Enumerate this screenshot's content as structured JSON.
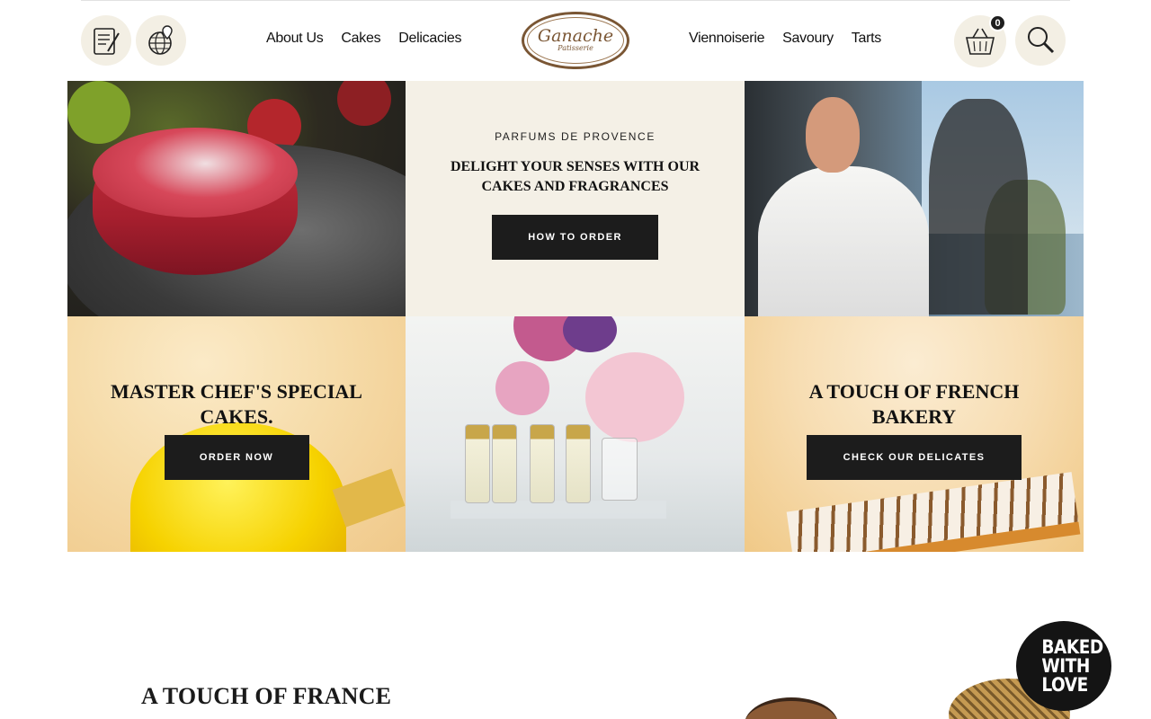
{
  "header": {
    "nav_left": [
      "About Us",
      "Cakes",
      "Delicacies"
    ],
    "nav_right": [
      "Viennoiserie",
      "Savoury",
      "Tarts"
    ],
    "logo": {
      "name": "Ganache",
      "sub": "Patisserie"
    },
    "cart_count": "0",
    "icons": [
      "order-form-icon",
      "globe-location-icon",
      "basket-icon",
      "search-icon"
    ]
  },
  "tiles": {
    "promo": {
      "eyebrow": "PARFUMS DE PROVENCE",
      "headline": "DELIGHT YOUR SENSES WITH OUR CAKES AND FRAGRANCES",
      "button": "HOW TO ORDER"
    },
    "special": {
      "title": "MASTER CHEF'S SPECIAL CAKES.",
      "button": "ORDER NOW"
    },
    "bakery": {
      "title": "A TOUCH OF FRENCH BAKERY",
      "button": "CHECK OUR DELICATES"
    }
  },
  "section": {
    "title": "A TOUCH OF FRANCE"
  },
  "stamp": {
    "lines": [
      "BAKED",
      "WITH",
      "LOVE"
    ]
  },
  "colors": {
    "cream": "#f4f0e6",
    "button": "#1c1c1c",
    "logo": "#7a5634"
  }
}
